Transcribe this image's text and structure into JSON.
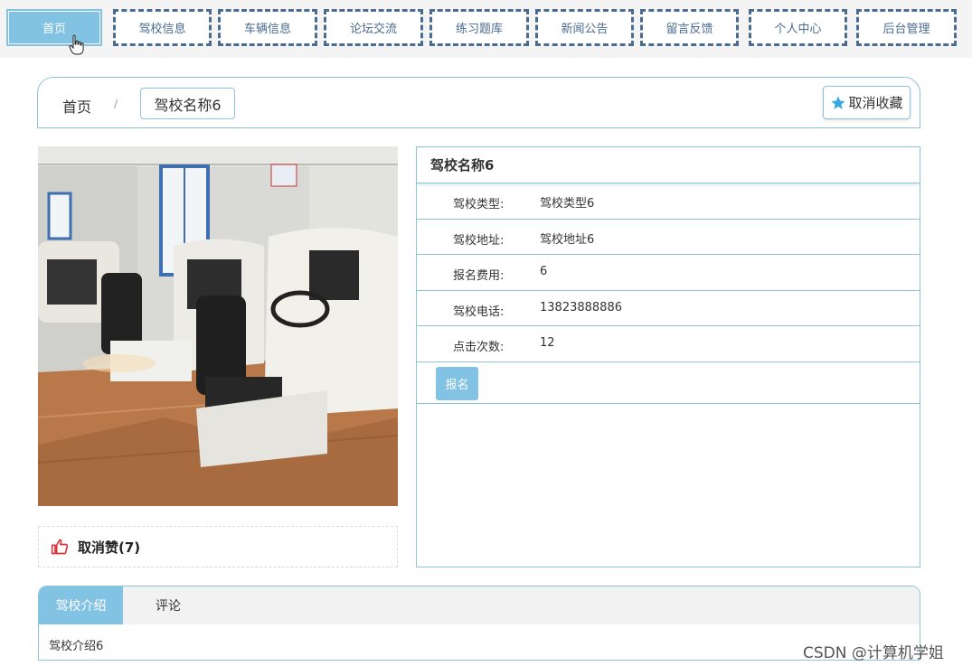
{
  "nav": {
    "items": [
      {
        "label": "首页"
      },
      {
        "label": "驾校信息"
      },
      {
        "label": "车辆信息"
      },
      {
        "label": "论坛交流"
      },
      {
        "label": "练习题库"
      },
      {
        "label": "新闻公告"
      },
      {
        "label": "留言反馈"
      },
      {
        "label": "个人中心"
      },
      {
        "label": "后台管理"
      }
    ],
    "active_index": 0
  },
  "breadcrumb": {
    "home": "首页",
    "separator": "/",
    "current": "驾校名称6"
  },
  "favorite": {
    "label": "取消收藏",
    "icon": "star-icon"
  },
  "like": {
    "label": "取消赞(7)",
    "icon": "thumbs-up-icon"
  },
  "detail": {
    "title": "驾校名称6",
    "rows": [
      {
        "key": "驾校类型:",
        "value": "驾校类型6"
      },
      {
        "key": "驾校地址:",
        "value": "驾校地址6"
      },
      {
        "key": "报名费用:",
        "value": "6"
      },
      {
        "key": "驾校电话:",
        "value": "13823888886"
      },
      {
        "key": "点击次数:",
        "value": "12"
      }
    ],
    "signup_label": "报名"
  },
  "tabs": {
    "items": [
      {
        "label": "驾校介绍"
      },
      {
        "label": "评论"
      }
    ],
    "active_index": 0,
    "content": "驾校介绍6"
  },
  "watermark": "CSDN @计算机学姐",
  "colors": {
    "accent": "#82c2e3",
    "border": "#8fc3d9",
    "nav_dashed": "#4a6b92",
    "like_icon": "#d9363e",
    "star_icon": "#3aa7e0"
  }
}
